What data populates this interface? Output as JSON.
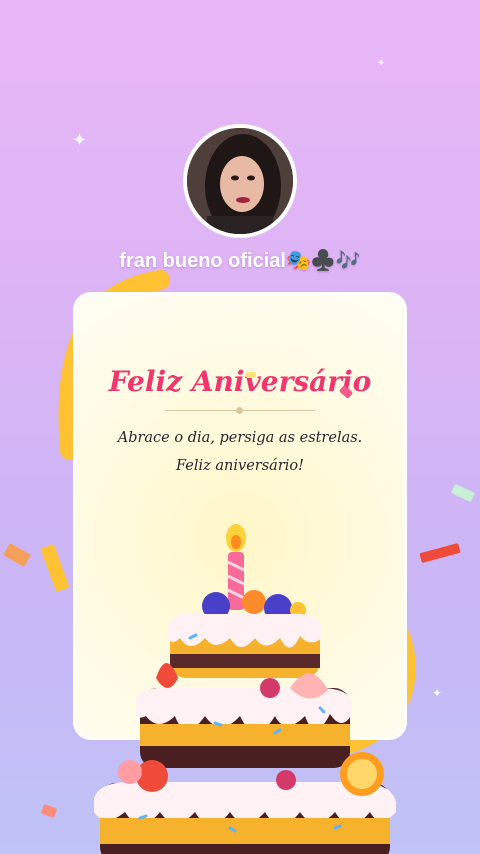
{
  "profile": {
    "avatar": "user-avatar-photo",
    "username": "fran bueno oficial🎭♣️🎶"
  },
  "card": {
    "title": "Feliz Aniversário",
    "message": "Abrace o dia, persiga as estrelas. Feliz aniversário!"
  },
  "colors": {
    "title": "#f1356e",
    "background_top": "#e9b7f7",
    "background_bottom": "#bfc3f7",
    "card": "#fffbe4"
  },
  "decorations": {
    "cake": "birthday-cake-icon",
    "candle": "candle-icon",
    "sparkles": "sparkle-icon",
    "ribbon": "ribbon-icon"
  }
}
